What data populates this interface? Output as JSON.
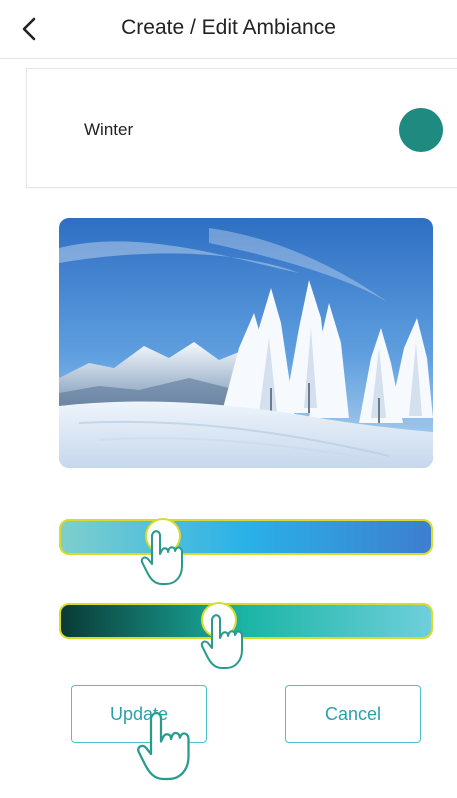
{
  "header": {
    "title": "Create / Edit Ambiance"
  },
  "ambiance": {
    "name": "Winter",
    "color": "#1e8a80"
  },
  "sliders": {
    "hue": {
      "value_fraction": 0.25,
      "gradient": [
        "#7fcfcd",
        "#29b1e8",
        "#3e7ed0"
      ]
    },
    "saturation": {
      "value_fraction": 0.42,
      "gradient": [
        "#0a3a35",
        "#1bb5a6",
        "#6fcfdc"
      ]
    }
  },
  "buttons": {
    "update_label": "Update",
    "cancel_label": "Cancel"
  },
  "colors": {
    "accent": "#2aa0ad",
    "border_accent": "#4cc3cc",
    "slider_outline": "#d7dc28"
  }
}
